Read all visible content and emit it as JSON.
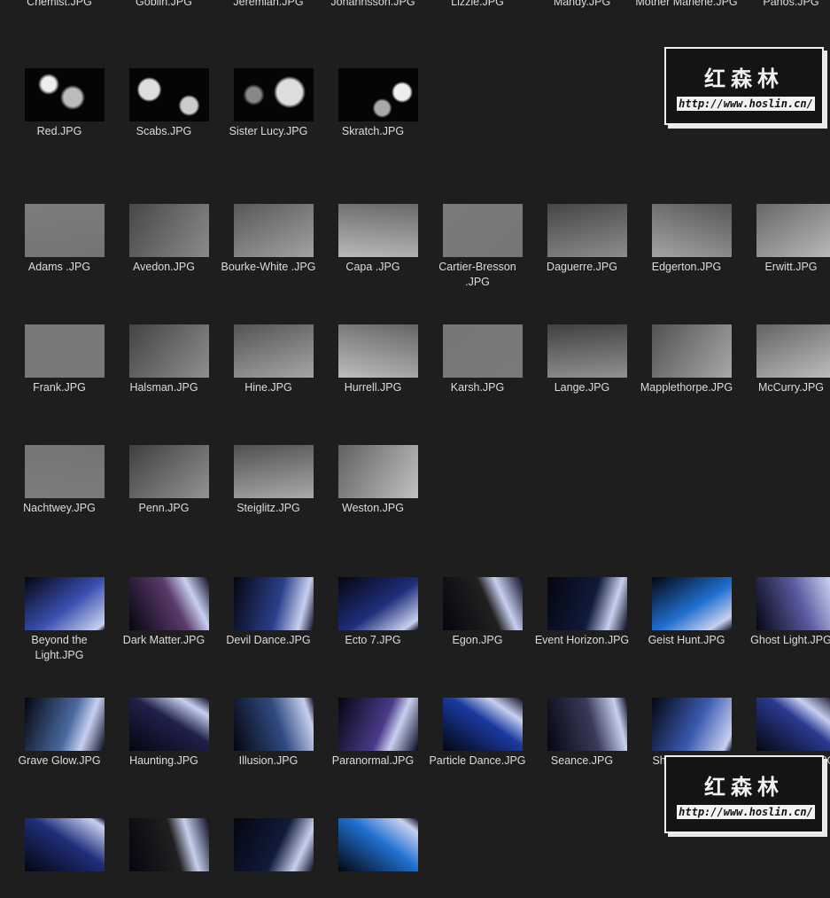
{
  "window": {
    "title": ""
  },
  "sections": [
    {
      "name": "partial-top",
      "rows": [
        [
          "Chemist.JPG",
          "Goblin.JPG",
          "Jeremiah.JPG",
          "Johannsson.JPG",
          "Lizzie.JPG",
          "Mandy.JPG",
          "Mother Marlene.JPG",
          "Panos.JPG"
        ]
      ]
    },
    {
      "name": "bokeh",
      "rows": [
        [
          "Red.JPG",
          "Scabs.JPG",
          "Sister Lucy.JPG",
          "Skratch.JPG"
        ]
      ]
    },
    {
      "name": "paper-textures",
      "rows": [
        [
          "Adams .JPG",
          "Avedon.JPG",
          "Bourke-White .JPG",
          "Capa .JPG",
          "Cartier-Bresson .JPG",
          "Daguerre.JPG",
          "Edgerton.JPG",
          "Erwitt.JPG"
        ],
        [
          "Frank.JPG",
          "Halsman.JPG",
          "Hine.JPG",
          "Hurrell.JPG",
          "Karsh.JPG",
          "Lange.JPG",
          "Mapplethorpe.JPG",
          "McCurry.JPG"
        ],
        [
          "Nachtwey.JPG",
          "Penn.JPG",
          "Steiglitz.JPG",
          "Weston.JPG"
        ]
      ]
    },
    {
      "name": "light-leaks",
      "rows": [
        [
          "Beyond the Light.JPG",
          "Dark Matter.JPG",
          "Devil Dance.JPG",
          "Ecto 7.JPG",
          "Egon.JPG",
          "Event Horizon.JPG",
          "Geist Hunt.JPG",
          "Ghost Light.JPG"
        ],
        [
          "Grave Glow.JPG",
          "Haunting.JPG",
          "Illusion.JPG",
          "Paranormal.JPG",
          "Particle Dance.JPG",
          "Seance.JPG",
          "Shimmer.JPG",
          "Space Vision.JPG"
        ]
      ]
    }
  ],
  "watermark": {
    "title": "红森林",
    "url": "http://www.hoslin.cn/"
  },
  "colors": {
    "background": "#1e1e1e",
    "label": "#dcdcdc"
  }
}
